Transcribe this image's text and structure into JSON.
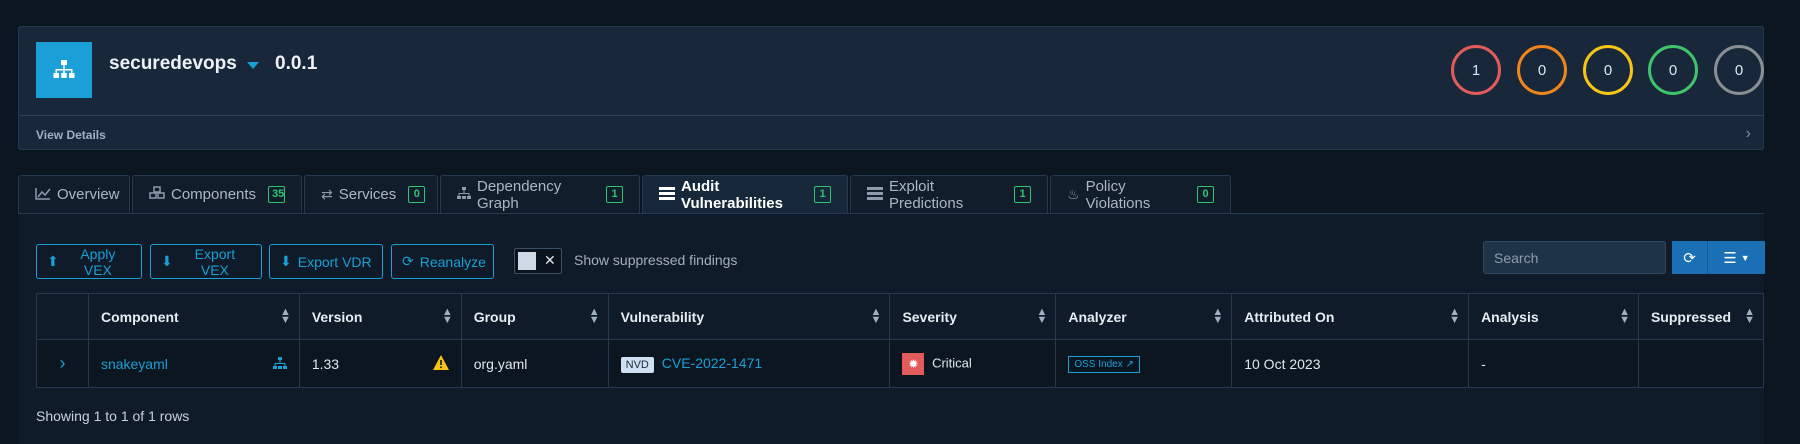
{
  "project": {
    "name": "securedevops",
    "version": "0.0.1",
    "view_details": "View Details"
  },
  "severity_counts": [
    {
      "name": "critical",
      "count": "1",
      "color": "#e35c5c"
    },
    {
      "name": "high",
      "count": "0",
      "color": "#f0861a"
    },
    {
      "name": "medium",
      "count": "0",
      "color": "#f5c518"
    },
    {
      "name": "low",
      "count": "0",
      "color": "#3fc36b"
    },
    {
      "name": "unassigned",
      "count": "0",
      "color": "#8a8f94"
    }
  ],
  "tabs": [
    {
      "label": "Overview",
      "icon": "chart-line-icon",
      "badge": ""
    },
    {
      "label": "Components",
      "icon": "cubes-icon",
      "badge": "35"
    },
    {
      "label": "Services",
      "icon": "exchange-icon",
      "badge": "0"
    },
    {
      "label": "Dependency Graph",
      "icon": "sitemap-icon",
      "badge": "1"
    },
    {
      "label": "Audit Vulnerabilities",
      "icon": "tasks-icon",
      "badge": "1"
    },
    {
      "label": "Exploit Predictions",
      "icon": "list-icon",
      "badge": "1"
    },
    {
      "label": "Policy Violations",
      "icon": "fire-icon",
      "badge": "0"
    }
  ],
  "toolbar": {
    "apply_vex": "Apply VEX",
    "export_vex": "Export VEX",
    "export_vdr": "Export VDR",
    "reanalyze": "Reanalyze",
    "show_suppressed": "Show suppressed findings",
    "search_placeholder": "Search"
  },
  "table": {
    "headers": [
      "Component",
      "Version",
      "Group",
      "Vulnerability",
      "Severity",
      "Analyzer",
      "Attributed On",
      "Analysis",
      "Suppressed"
    ],
    "rows": [
      {
        "component": "snakeyaml",
        "version": "1.33",
        "group": "org.yaml",
        "source": "NVD",
        "vulnerability": "CVE-2022-1471",
        "severity": "Critical",
        "analyzer": "OSS Index",
        "attributed_on": "10 Oct 2023",
        "analysis": "-",
        "suppressed": ""
      }
    ]
  },
  "footer": {
    "showing": "Showing 1 to 1 of 1 rows"
  },
  "colors": {
    "accent": "#1a9fd6",
    "badge_green": "#2fc470",
    "critical": "#e35c5c",
    "warning": "#f5c518"
  }
}
